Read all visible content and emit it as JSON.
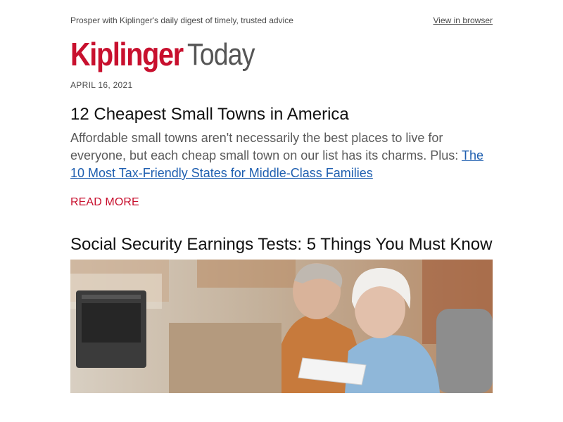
{
  "preheader": {
    "tagline": "Prosper with Kiplinger's daily digest of timely, trusted advice",
    "view_in_browser": "View in browser"
  },
  "logo": {
    "brand": "Kiplinger",
    "product": "Today"
  },
  "date": "APRIL 16, 2021",
  "articles": [
    {
      "title": "12 Cheapest Small Towns in America",
      "summary": "Affordable small towns aren't necessarily the best places to live for everyone, but each cheap small town on our list has its charms. Plus: ",
      "link_text": "The 10 Most Tax-Friendly States for Middle-Class Families",
      "cta": "READ MORE"
    },
    {
      "title": "Social Security Earnings Tests: 5 Things You Must Know",
      "image_alt": "older couple reviewing a document"
    }
  ],
  "colors": {
    "brand_red": "#c8102e",
    "link_blue": "#1f5fb0",
    "text_gray": "#5a5a5a"
  }
}
